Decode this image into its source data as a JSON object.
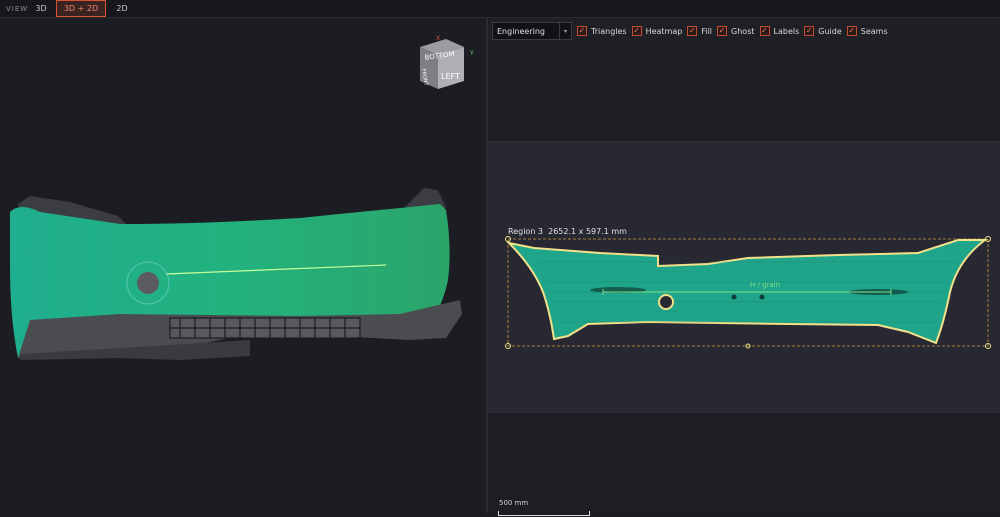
{
  "topbar": {
    "view_label": "VIEW",
    "tabs": [
      {
        "label": "3D",
        "active": false
      },
      {
        "label": "3D + 2D",
        "active": true
      },
      {
        "label": "2D",
        "active": false
      }
    ]
  },
  "viewcube": {
    "faces": {
      "front": "BOTTOM",
      "side": "LEFT",
      "top": "FRONT"
    },
    "axes": {
      "x": "X",
      "y": "Y"
    }
  },
  "toolbar": {
    "mode_select": "Engineering",
    "toggles": [
      {
        "label": "Triangles",
        "checked": true
      },
      {
        "label": "Heatmap",
        "checked": true
      },
      {
        "label": "Fill",
        "checked": true
      },
      {
        "label": "Ghost",
        "checked": true
      },
      {
        "label": "Labels",
        "checked": true
      },
      {
        "label": "Guide",
        "checked": true
      },
      {
        "label": "Seams",
        "checked": true
      }
    ]
  },
  "flat_view": {
    "region_label": "Region 3",
    "region_dims": "2652.1 x 597.1 mm",
    "grain_label": "H / grain",
    "scale_label": "500 mm"
  },
  "colors": {
    "accent": "#d8533a",
    "mesh_green": "#1fa58a",
    "outline": "#f2e08a",
    "grain_line": "#7fe08a"
  }
}
